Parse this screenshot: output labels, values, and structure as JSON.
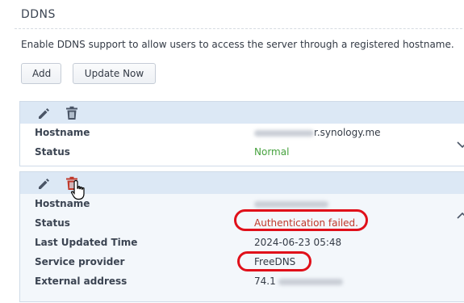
{
  "section": {
    "title": "DDNS",
    "description": "Enable DDNS support to allow users to access the server through a registered hostname."
  },
  "toolbar": {
    "add_label": "Add",
    "update_label": "Update Now"
  },
  "entries": [
    {
      "hostname_label": "Hostname",
      "hostname_value": "r.synology.me",
      "status_label": "Status",
      "status_value": "Normal",
      "expanded": false
    },
    {
      "hostname_label": "Hostname",
      "status_label": "Status",
      "status_value": "Authentication failed.",
      "last_updated_label": "Last Updated Time",
      "last_updated_value": "2024-06-23 05:48",
      "provider_label": "Service provider",
      "provider_value": "FreeDNS",
      "external_label": "External address",
      "external_value": "74.1",
      "expanded": true
    }
  ],
  "colors": {
    "status_normal": "#47a23f",
    "status_error": "#c0392b",
    "annotation": "#e0101a",
    "row_header": "#dce8f5"
  },
  "icons": {
    "edit": "pencil-icon",
    "delete": "trash-icon",
    "expand": "chevron-down-icon",
    "collapse": "chevron-up-icon",
    "cursor": "hand-pointer-icon"
  }
}
